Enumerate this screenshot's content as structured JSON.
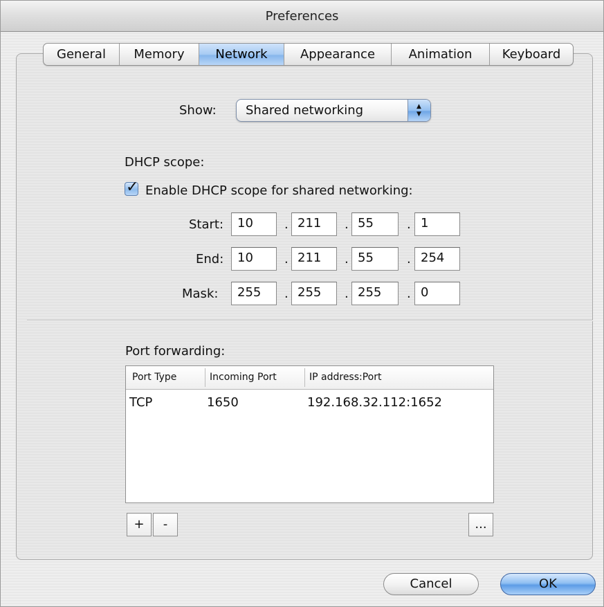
{
  "window": {
    "title": "Preferences"
  },
  "tabs": [
    {
      "label": "General",
      "active": false
    },
    {
      "label": "Memory",
      "active": false
    },
    {
      "label": "Network",
      "active": true
    },
    {
      "label": "Appearance",
      "active": false
    },
    {
      "label": "Animation",
      "active": false
    },
    {
      "label": "Keyboard",
      "active": false
    }
  ],
  "show": {
    "label": "Show:",
    "selected": "Shared networking"
  },
  "dhcp": {
    "section_label": "DHCP scope:",
    "enable_label": "Enable DHCP scope for shared networking:",
    "enabled": true,
    "separator": ".",
    "start": {
      "label": "Start:",
      "octets": [
        "10",
        "211",
        "55",
        "1"
      ]
    },
    "end": {
      "label": "End:",
      "octets": [
        "10",
        "211",
        "55",
        "254"
      ]
    },
    "mask": {
      "label": "Mask:",
      "octets": [
        "255",
        "255",
        "255",
        "0"
      ]
    }
  },
  "port_forwarding": {
    "label": "Port forwarding:",
    "columns": [
      "Port Type",
      "Incoming Port",
      "IP address:Port"
    ],
    "rows": [
      {
        "type": "TCP",
        "incoming": "1650",
        "address": "192.168.32.112:1652"
      }
    ],
    "add_label": "+",
    "remove_label": "-",
    "more_label": "..."
  },
  "buttons": {
    "cancel": "Cancel",
    "ok": "OK"
  },
  "colors": {
    "accent": "#6fa6e6",
    "tab_active": "#a7cbf3"
  }
}
